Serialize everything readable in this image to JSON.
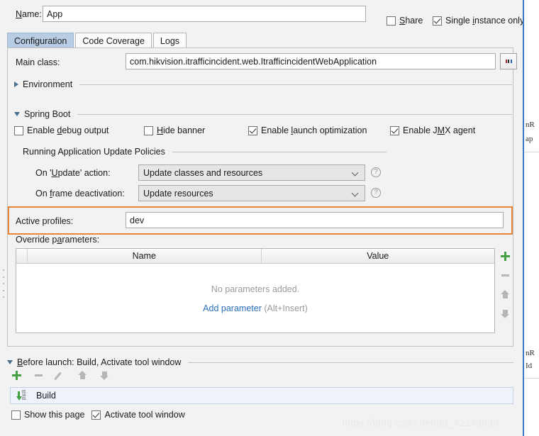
{
  "name_row": {
    "label": "Name:",
    "value": "App",
    "share_label": "Share",
    "share_checked": false,
    "single_instance_label": "Single instance only",
    "single_instance_checked": true
  },
  "tabs": [
    {
      "label": "Configuration",
      "active": true
    },
    {
      "label": "Code Coverage",
      "active": false
    },
    {
      "label": "Logs",
      "active": false
    }
  ],
  "main_class": {
    "label": "Main class:",
    "value": "com.hikvision.itrafficincident.web.ItrafficincidentWebApplication",
    "browse_icon": "ellipsis-icon"
  },
  "environment_section": {
    "label": "Environment",
    "expanded": false
  },
  "spring_boot_section": {
    "label": "Spring Boot",
    "expanded": true,
    "checkboxes": [
      {
        "label": "Enable debug output",
        "checked": false,
        "mnemonic": "d"
      },
      {
        "label": "Hide banner",
        "checked": false,
        "mnemonic": "H"
      },
      {
        "label": "Enable launch optimization",
        "checked": true,
        "mnemonic": "l"
      },
      {
        "label": "Enable JMX agent",
        "checked": true,
        "mnemonic": "M"
      }
    ]
  },
  "update_policies": {
    "title": "Running Application Update Policies",
    "rows": [
      {
        "label": "On 'Update' action:",
        "value": "Update classes and resources",
        "help": "?"
      },
      {
        "label": "On frame deactivation:",
        "value": "Update resources",
        "help": "?"
      }
    ]
  },
  "active_profiles": {
    "label": "Active profiles:",
    "value": "dev",
    "highlight_color": "#e8873a"
  },
  "override_parameters": {
    "label": "Override parameters:",
    "columns": [
      "",
      "Name",
      "Value"
    ],
    "rows": [],
    "empty_message": "No parameters added.",
    "add_link": "Add parameter",
    "add_shortcut": "(Alt+Insert)",
    "tools": [
      "add-icon",
      "remove-icon",
      "move-up-icon",
      "move-down-icon"
    ]
  },
  "before_launch": {
    "label": "Before launch: Build, Activate tool window",
    "expanded": true,
    "tools": [
      "add-icon",
      "remove-icon",
      "edit-icon",
      "move-up-icon",
      "move-down-icon"
    ],
    "items": [
      {
        "label": "Build",
        "icon": "build-icon"
      }
    ],
    "checkboxes": [
      {
        "label": "Show this page",
        "checked": false
      },
      {
        "label": "Activate tool window",
        "checked": true
      }
    ]
  },
  "background_panel": {
    "fragments": [
      "nR",
      "ap",
      "nR",
      "Id"
    ]
  },
  "watermark": "https://blog.csdn.net/qq_42243639"
}
